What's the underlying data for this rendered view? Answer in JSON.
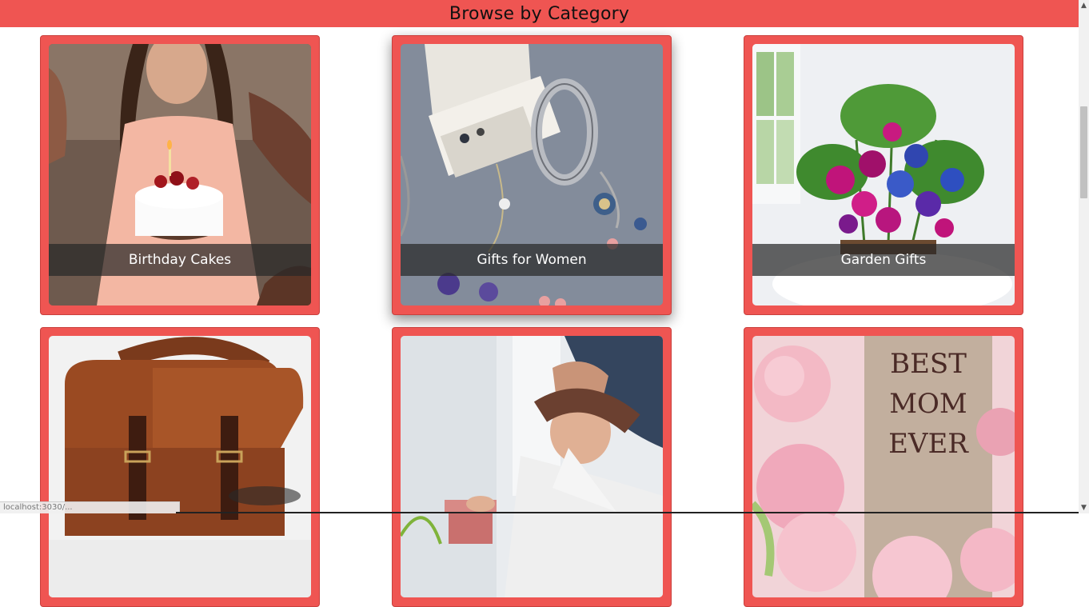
{
  "header": {
    "title": "Browse by Category"
  },
  "categories": [
    {
      "label": "Birthday Cakes"
    },
    {
      "label": "Gifts for Women"
    },
    {
      "label": "Garden Gifts"
    },
    {
      "label": ""
    },
    {
      "label": ""
    },
    {
      "label": "Best Mom Ever",
      "sign_lines": [
        "BEST",
        "MOM",
        "EVER"
      ]
    }
  ],
  "status": {
    "url": "localhost:3030/..."
  },
  "colors": {
    "accent": "#ef5552",
    "caption_bg": "#3a3a3a"
  }
}
